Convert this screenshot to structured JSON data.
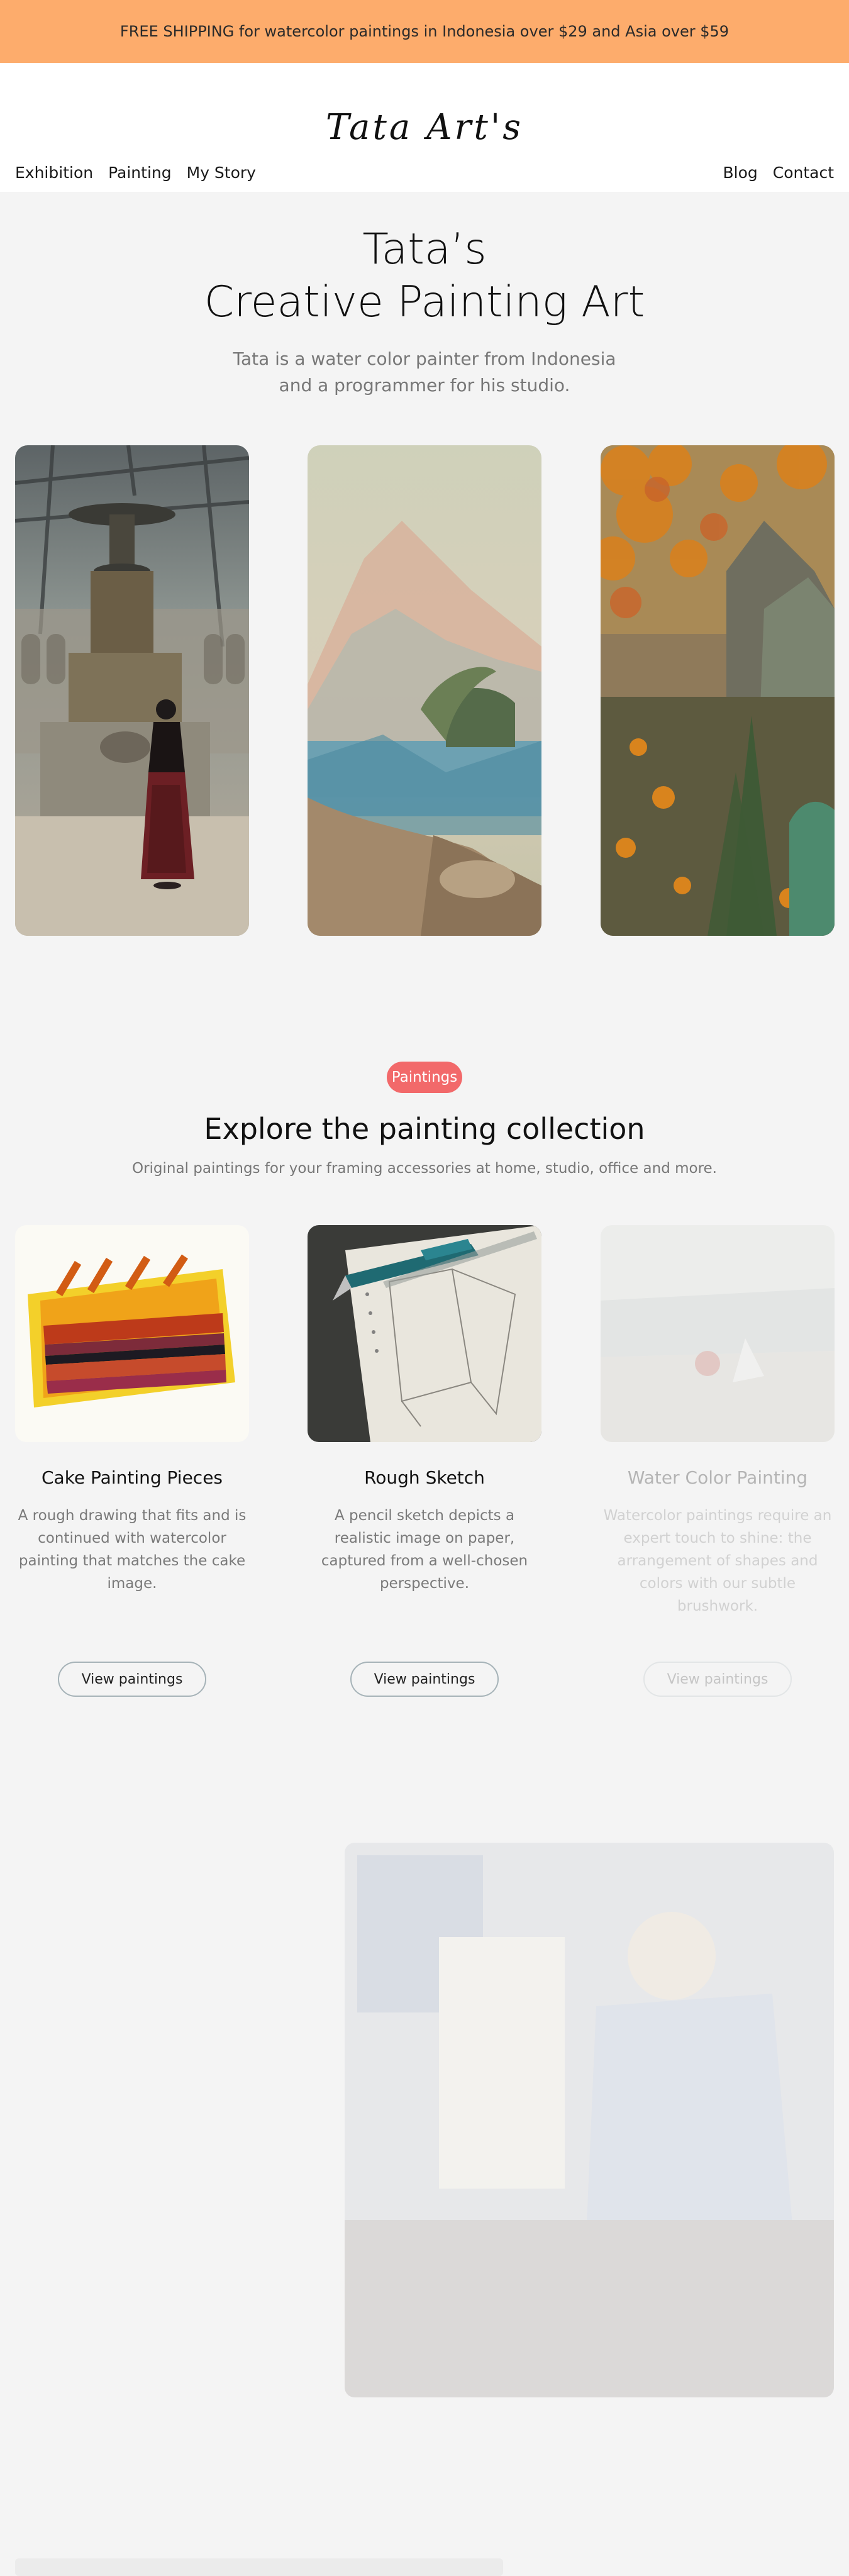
{
  "promo": {
    "text": "FREE SHIPPING for watercolor paintings in Indonesia over $29 and Asia over $59"
  },
  "header": {
    "logo": "Tata Art's",
    "nav_left": [
      "Exhibition",
      "Painting",
      "My Story"
    ],
    "nav_right": [
      "Blog",
      "Contact"
    ]
  },
  "hero": {
    "title_line1": "Tata’s",
    "title_line2": "Creative Painting Art",
    "subtitle": "Tata is a water color painter from Indonesia and a programmer for his studio."
  },
  "collection": {
    "badge": "Paintings",
    "title": "Explore the painting collection",
    "subtitle": "Original paintings for your framing accessories at home, studio, office and more.",
    "cards": [
      {
        "title": "Cake Painting Pieces",
        "description": "A rough drawing that fits and is continued with watercolor painting that matches the cake image.",
        "button": "View paintings"
      },
      {
        "title": "Rough Sketch",
        "description": "A pencil sketch depicts a realistic image on paper, captured from a well-chosen perspective.",
        "button": "View paintings"
      },
      {
        "title": "Water Color Painting",
        "description": "Watercolor paintings require an expert touch to shine: the arrangement of shapes and colors with our subtle brushwork.",
        "button": "View paintings"
      }
    ]
  },
  "colors": {
    "promo_bg": "#fdac6c",
    "badge_bg": "#f2696a",
    "page_bg": "#f4f4f4"
  }
}
